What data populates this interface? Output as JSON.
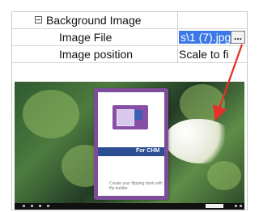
{
  "property_grid": {
    "group_label": "Background Image",
    "rows": [
      {
        "name": "Image File",
        "value": "s\\1 (7).jpg",
        "button": "..."
      },
      {
        "name": "Image position",
        "value": "Scale to fi"
      }
    ]
  },
  "preview": {
    "book_band_text": "For CHM",
    "book_footer_text": "Create your flipping book with flip builder"
  },
  "colors": {
    "selection": "#3b78e8",
    "arrow": "#e4322b",
    "book_border": "#7d4d9c"
  }
}
